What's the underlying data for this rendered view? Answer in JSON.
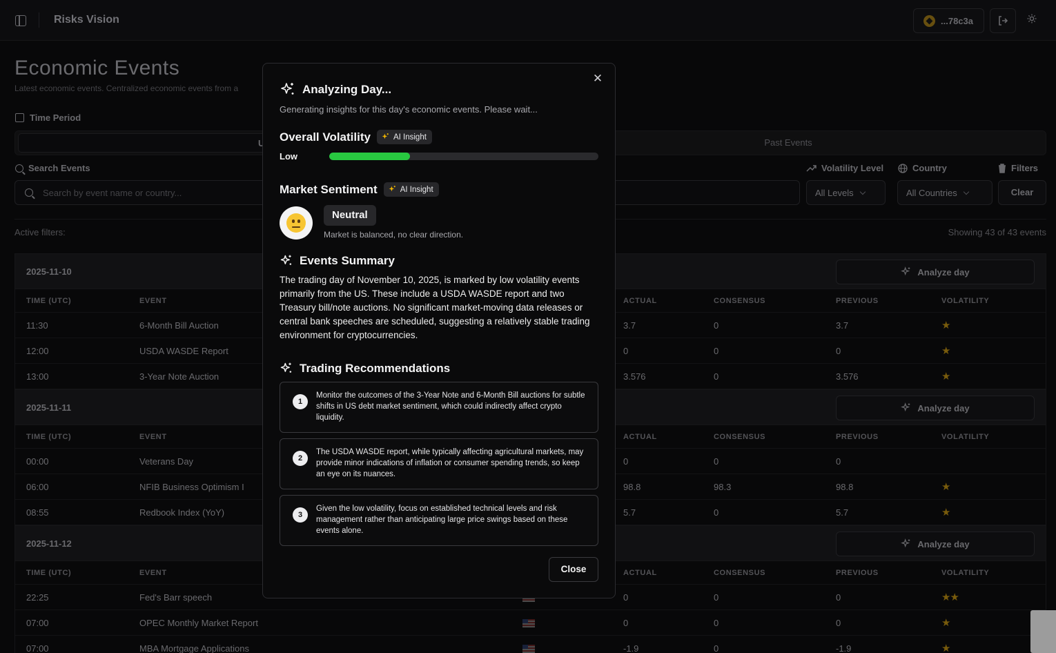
{
  "app": {
    "title": "Risks Vision",
    "wallet": "...78c3a"
  },
  "page": {
    "title": "Economic Events",
    "subtitle": "Latest economic events. Centralized economic events from a",
    "time_period_label": "Time Period",
    "tabs": {
      "upcoming": "Upcom",
      "past": "Past Events"
    },
    "search_label": "Search Events",
    "search_placeholder": "Search by event name or country...",
    "volatility_label": "Volatility Level",
    "country_label": "Country",
    "filters_label": "Filters",
    "levels_select": "All Levels",
    "countries_select": "All Countries",
    "clear_label": "Clear",
    "active_filters": "Active filters:",
    "showing": "Showing 43 of 43 events",
    "analyze_label": "Analyze day",
    "columns": {
      "time": "TIME (UTC)",
      "event": "EVENT",
      "actual": "ACTUAL",
      "consensus": "CONSENSUS",
      "previous": "PREVIOUS",
      "volatility": "VOLATILITY"
    }
  },
  "days": [
    {
      "date": "2025-11-10",
      "rows": [
        {
          "time": "11:30",
          "event": "6-Month Bill Auction",
          "actual": "3.7",
          "consensus": "0",
          "previous": "3.7",
          "stars": "★"
        },
        {
          "time": "12:00",
          "event": "USDA WASDE Report",
          "actual": "0",
          "consensus": "0",
          "previous": "0",
          "stars": "★"
        },
        {
          "time": "13:00",
          "event": "3-Year Note Auction",
          "actual": "3.576",
          "consensus": "0",
          "previous": "3.576",
          "stars": "★"
        }
      ]
    },
    {
      "date": "2025-11-11",
      "rows": [
        {
          "time": "00:00",
          "event": "Veterans Day",
          "actual": "0",
          "consensus": "0",
          "previous": "0",
          "stars": ""
        },
        {
          "time": "06:00",
          "event": "NFIB Business Optimism I",
          "actual": "98.8",
          "consensus": "98.3",
          "previous": "98.8",
          "stars": "★"
        },
        {
          "time": "08:55",
          "event": "Redbook Index (YoY)",
          "actual": "5.7",
          "consensus": "0",
          "previous": "5.7",
          "stars": "★"
        }
      ]
    },
    {
      "date": "2025-11-12",
      "rows": [
        {
          "time": "22:25",
          "event": "Fed's Barr speech",
          "actual": "0",
          "consensus": "0",
          "previous": "0",
          "stars": "★★"
        },
        {
          "time": "07:00",
          "event": "OPEC Monthly Market Report",
          "actual": "0",
          "consensus": "0",
          "previous": "0",
          "stars": "★"
        },
        {
          "time": "07:00",
          "event": "MBA Mortgage Applications",
          "actual": "-1.9",
          "consensus": "0",
          "previous": "-1.9",
          "stars": "★"
        }
      ]
    }
  ],
  "modal": {
    "title": "Analyzing Day...",
    "subtitle": "Generating insights for this day's economic events. Please wait...",
    "ai_badge": "AI Insight",
    "volatility": {
      "title": "Overall Volatility",
      "level": "Low",
      "fill_percent": 30
    },
    "sentiment": {
      "title": "Market Sentiment",
      "value": "Neutral",
      "description": "Market is balanced, no clear direction."
    },
    "summary": {
      "title": "Events Summary",
      "text": "The trading day of November 10, 2025, is marked by low volatility events primarily from the US. These include a USDA WASDE report and two Treasury bill/note auctions. No significant market-moving data releases or central bank speeches are scheduled, suggesting a relatively stable trading environment for cryptocurrencies."
    },
    "recommendations": {
      "title": "Trading Recommendations",
      "items": [
        {
          "num": "1",
          "text": "Monitor the outcomes of the 3-Year Note and 6-Month Bill auctions for subtle shifts in US debt market sentiment, which could indirectly affect crypto liquidity."
        },
        {
          "num": "2",
          "text": "The USDA WASDE report, while typically affecting agricultural markets, may provide minor indications of inflation or consumer spending trends, so keep an eye on its nuances."
        },
        {
          "num": "3",
          "text": "Given the low volatility, focus on established technical levels and risk management rather than anticipating large price swings based on these events alone."
        }
      ]
    },
    "close_label": "Close"
  },
  "colors": {
    "accent_green": "#28c840",
    "badge_bg": "#27272a",
    "star": "#f5b800"
  }
}
